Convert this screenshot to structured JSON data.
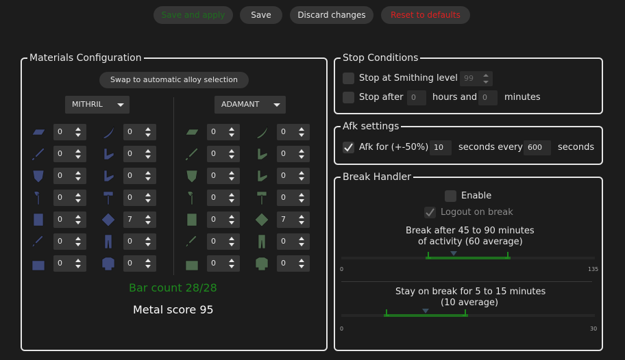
{
  "toolbar": {
    "save_and_apply": "Save and apply",
    "save": "Save",
    "discard": "Discard changes",
    "reset": "Reset to defaults",
    "save_and_apply_color": "#1e6e1e",
    "reset_color": "#e02020"
  },
  "materials": {
    "title": "Materials Configuration",
    "swap_button": "Swap to automatic alloy selection",
    "left_metal": "MITHRIL",
    "right_metal": "ADAMANT",
    "left_items": [
      {
        "icon": "bar-icon",
        "value": "0"
      },
      {
        "icon": "scimitar-icon",
        "value": "0"
      },
      {
        "icon": "sword-icon",
        "value": "0"
      },
      {
        "icon": "claws-icon",
        "value": "0"
      },
      {
        "icon": "kiteshield-icon",
        "value": "0"
      },
      {
        "icon": "claws-icon",
        "value": "0"
      },
      {
        "icon": "axe-icon",
        "value": "0"
      },
      {
        "icon": "warhammer-icon",
        "value": "0"
      },
      {
        "icon": "platebody-icon",
        "value": "0"
      },
      {
        "icon": "sq-shield-icon",
        "value": "7"
      },
      {
        "icon": "dagger-icon",
        "value": "0"
      },
      {
        "icon": "platelegs-icon",
        "value": "0"
      },
      {
        "icon": "boots-icon",
        "value": "0"
      },
      {
        "icon": "chainbody-icon",
        "value": "0"
      }
    ],
    "right_items": [
      {
        "icon": "bar-icon",
        "value": "0"
      },
      {
        "icon": "scimitar-icon",
        "value": "0"
      },
      {
        "icon": "sword-icon",
        "value": "0"
      },
      {
        "icon": "claws-icon",
        "value": "0"
      },
      {
        "icon": "kiteshield-icon",
        "value": "0"
      },
      {
        "icon": "claws-icon",
        "value": "0"
      },
      {
        "icon": "axe-icon",
        "value": "0"
      },
      {
        "icon": "warhammer-icon",
        "value": "0"
      },
      {
        "icon": "platebody-icon",
        "value": "0"
      },
      {
        "icon": "sq-shield-icon",
        "value": "7"
      },
      {
        "icon": "dagger-icon",
        "value": "0"
      },
      {
        "icon": "platelegs-icon",
        "value": "0"
      },
      {
        "icon": "boots-icon",
        "value": "0"
      },
      {
        "icon": "chainbody-icon",
        "value": "0"
      }
    ],
    "mithril_color": "#3f4a7a",
    "adamant_color": "#4e6a4e",
    "bar_count": "Bar count 28/28",
    "bar_count_color": "#1e8a1e",
    "metal_score": "Metal score 95"
  },
  "stop_conditions": {
    "title": "Stop Conditions",
    "level_label": "Stop at Smithing level",
    "level_value": "99",
    "after_label": "Stop after",
    "hours_value": "0",
    "hours_label": "hours and",
    "minutes_value": "0",
    "minutes_label": "minutes"
  },
  "afk": {
    "title": "Afk settings",
    "checked": true,
    "label": "Afk for (+-50%)",
    "seconds_value": "10",
    "every_label": "seconds every",
    "interval_value": "600",
    "seconds_label": "seconds"
  },
  "break_handler": {
    "title": "Break Handler",
    "enable_label": "Enable",
    "logout_label": "Logout on break",
    "break_after_line1": "Break after 45 to 90 minutes",
    "break_after_line2": "of activity (60 average)",
    "slider1": {
      "min_label": "0",
      "max_label": "135",
      "min": 0,
      "max": 135,
      "low": 45,
      "high": 90,
      "avg": 60
    },
    "stay_line1": "Stay on break for 5 to 15 minutes",
    "stay_line2": "(10 average)",
    "slider2": {
      "min_label": "0",
      "max_label": "30",
      "min": 0,
      "max": 30,
      "low": 5,
      "high": 15,
      "avg": 10
    }
  }
}
